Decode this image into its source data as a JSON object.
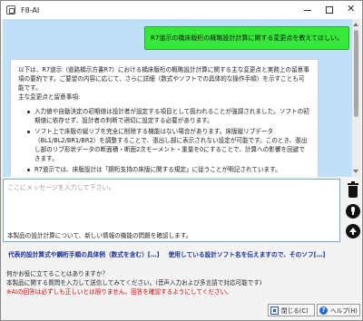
{
  "window": {
    "title": "F8-AI"
  },
  "chat": {
    "user_message": "R7道示の橋床版桁の概略設計計算に関する変更点を教えてほしい。",
    "ai_intro": "以下は、R7道示（道路橋示方書R7）における橋床版桁の概略設計計算に関する主な変更点と実務上の留意事項の要約です。ご要望の内容に応じて、さらに詳細（数式やソフトでの具体的な操作手順）を示すことも可能です。",
    "ai_subheading": "主な変更点と留意事項:",
    "ai_bullets": [
      "入力値や自動決定の初期値は設計者が設定する項目として扱われることが強調されました。ソフトの初期値に依存せず、設計者の判断で適切に設定する必要があります。",
      "ソフト上で床版の縦リブを完全に削除する機能はない場合があります。床版縦リブデータ（BL1/BL2/BR1/BR2）を調整することで、張出し部に表示されない設定が可能です。このとき、張出し部のリブ形状データの断面積・断面2次モーメント・重量を0にすることで、計算への影響を回避できます。",
      "R7道示では、床版設計は「鋼桁支持の床版に関する規定」に従うことが明記されています。"
    ]
  },
  "input": {
    "placeholder": "ここにメッセージを入力して下さい。",
    "overlay_text": "本製品の設計計算について、新しい情報の機能の問題を確認します。"
  },
  "suggestions": [
    "代表的設計算式や鋼桁手順の具体例（数式を含む）[…]",
    "使用している設計ソフト名を伝えますので、そのソフ[…]"
  ],
  "info": {
    "line1": "何かお役に立てることはありますか？",
    "line2": "本製品に関する質問を入力して送信してみてください。(音声入力および多言語で対応可能です)",
    "warning": "※AIの回答は必ずしも正しいとは限りません。回答を確認するようにしてください。"
  },
  "buttons": {
    "close": "閉じる(C)",
    "help": "ヘルプ(H)"
  }
}
